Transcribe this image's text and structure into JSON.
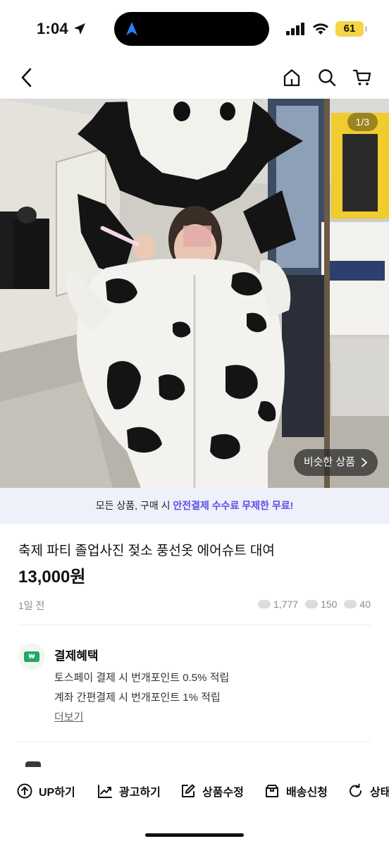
{
  "status_bar": {
    "time": "1:04",
    "battery": "61"
  },
  "header": {
    "back_icon": "chevron-left-icon",
    "icons": [
      "home-icon",
      "search-icon",
      "cart-icon"
    ]
  },
  "photo": {
    "counter": "1/3",
    "similar_button": "비슷한 상품"
  },
  "promo": {
    "prefix": "모든 상품, 구매 시 ",
    "highlight": "안전결제 수수료 무제한 무료!"
  },
  "product": {
    "title": "축제 파티 졸업사진 젖소 풍선옷 에어슈트 대여",
    "price": "13,000원",
    "posted": "1일 전",
    "stats": {
      "views": "1,777",
      "chats": "150",
      "likes": "40"
    }
  },
  "benefit": {
    "title": "결제혜택",
    "lines": [
      "토스페이 결제 시 번개포인트 0.5% 적립",
      "계좌 간편결제 시 번개포인트 1% 적립"
    ],
    "more": "더보기"
  },
  "toolbar": {
    "items": [
      {
        "label": "UP하기",
        "icon": "up-arrow-circle-icon"
      },
      {
        "label": "광고하기",
        "icon": "chart-icon"
      },
      {
        "label": "상품수정",
        "icon": "edit-icon"
      },
      {
        "label": "배송신청",
        "icon": "box-icon"
      },
      {
        "label": "상태",
        "icon": "refresh-icon"
      }
    ]
  }
}
